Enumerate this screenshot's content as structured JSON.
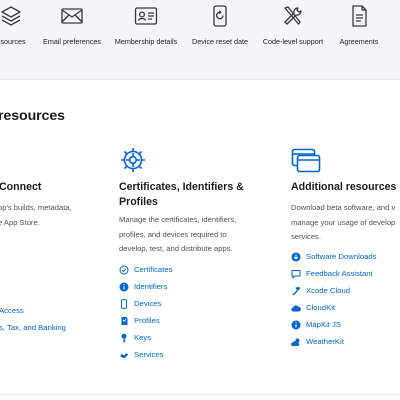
{
  "nav_tiles": [
    {
      "icon": "layers-icon",
      "label": "esources"
    },
    {
      "icon": "envelope-icon",
      "label": "Email preferences"
    },
    {
      "icon": "id-card-icon",
      "label": "Membership details"
    },
    {
      "icon": "device-reset-icon",
      "label": "Device reset date"
    },
    {
      "icon": "tools-icon",
      "label": "Code-level support"
    },
    {
      "icon": "document-icon",
      "label": "Agreements"
    }
  ],
  "section_title": "resources",
  "columns": {
    "left": {
      "title": "Connect",
      "desc": [
        "pp's builds, metadata,",
        "e App Store."
      ],
      "links": [
        {
          "icon": "",
          "label": "Access"
        },
        {
          "icon": "",
          "label": "s, Tax, and Banking"
        }
      ]
    },
    "middle": {
      "icon": "gear-icon",
      "title": [
        "Certificates, Identifiers &",
        "Profiles"
      ],
      "desc": [
        "Manage the certificates, identifiers,",
        "profiles, and devices required to",
        "develop, test, and distribute apps."
      ],
      "links": [
        {
          "icon": "certificate-icon",
          "label": "Certificates"
        },
        {
          "icon": "identifier-icon",
          "label": "Identifiers"
        },
        {
          "icon": "device-icon",
          "label": "Devices"
        },
        {
          "icon": "profile-icon",
          "label": "Profiles"
        },
        {
          "icon": "key-icon",
          "label": "Keys"
        },
        {
          "icon": "services-icon",
          "label": "Services"
        }
      ]
    },
    "right": {
      "icon": "windows-icon",
      "title": "Additional resources",
      "desc": [
        "Download beta software, and v",
        "manage your usage of develop",
        "services."
      ],
      "links": [
        {
          "icon": "download-icon",
          "label": "Software Downloads"
        },
        {
          "icon": "feedback-icon",
          "label": "Feedback Assistant"
        },
        {
          "icon": "hammer-icon",
          "label": "Xcode Cloud"
        },
        {
          "icon": "cloud-icon",
          "label": "CloudKit"
        },
        {
          "icon": "info-icon",
          "label": "MapKit JS"
        },
        {
          "icon": "weather-icon",
          "label": "WeatherKit"
        }
      ]
    }
  },
  "colors": {
    "link": "#0066cc",
    "text": "#1d1d1f",
    "muted": "#515154",
    "band": "#f5f5f7"
  }
}
